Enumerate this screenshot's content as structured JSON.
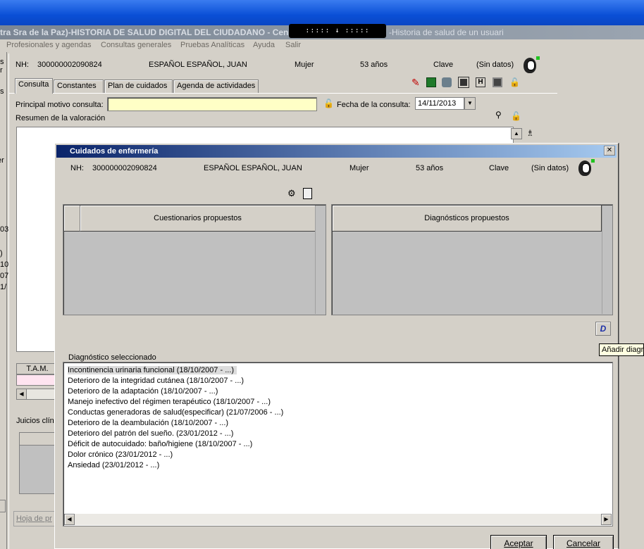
{
  "window": {
    "title_left": "tra Sra de la Paz)-HISTORIA DE SALUD DIGITAL DEL CIUDADANO - Cen",
    "title_right": "-Historia de salud de un usuari",
    "remote_bar": "::::: ↓ :::::"
  },
  "menu": [
    "Profesionales y agendas",
    "Consultas generales",
    "Pruebas Analíticas",
    "Ayuda",
    "Salir"
  ],
  "left_fragments": [
    "s r",
    "s",
    "er",
    "03",
    ")",
    "10",
    "07",
    "1/"
  ],
  "patient": {
    "nh_label": "NH:",
    "nh": "300000002090824",
    "name": "ESPAÑOL ESPAÑOL, JUAN",
    "sex": "Mujer",
    "age": "53 años",
    "clave_label": "Clave",
    "clave_value": "(Sin datos)"
  },
  "tabs": [
    "Consulta",
    "Constantes",
    "Plan de cuidados",
    "Agenda de actividades"
  ],
  "consulta": {
    "motivo_label": "Principal motivo consulta:",
    "motivo_value": "",
    "fecha_label": "Fecha de la consulta:",
    "fecha_value": "14/11/2013",
    "resumen_label": "Resumen de la valoración",
    "tam_label": "T.A.M.",
    "juicios_label": "Juicios clín",
    "hoja_button": "Hoja de pr"
  },
  "dialog": {
    "title": "Cuidados de enfermería",
    "close": "✕",
    "cuestionarios_header": "Cuestionarios propuestos",
    "diagnosticos_header": "Diagnósticos propuestos",
    "add_button": "D",
    "tooltip": "Añadir diagr",
    "diag_group_label": "Diagnóstico seleccionado",
    "diagnoses": [
      "Incontinencia urinaria funcional (18/10/2007 - ...)",
      "Deterioro de la integridad cutánea (18/10/2007 - ...)",
      "Deterioro de la adaptación (18/10/2007 - ...)",
      "Manejo inefectivo del régimen terapéutico (18/10/2007 - ...)",
      "Conductas generadoras de salud(especificar) (21/07/2006 - ...)",
      "Deterioro de la deambulación (18/10/2007 - ...)",
      "Deterioro del patrón del sueño. (23/01/2012 - ...)",
      "Déficit de autocuidado: baño/higiene (18/10/2007 - ...)",
      "Dolor crónico (23/01/2012 - ...)",
      "Ansiedad (23/01/2012 - ...)"
    ],
    "accept_button": "Aceptar",
    "cancel_button": "Cancelar"
  },
  "colors": {
    "topbar": "#0a4fd6",
    "dialog_title_start": "#0a246a",
    "dialog_title_end": "#a6caf0",
    "motivo_bg": "#ffffc6",
    "status_flag": "#21c321"
  }
}
